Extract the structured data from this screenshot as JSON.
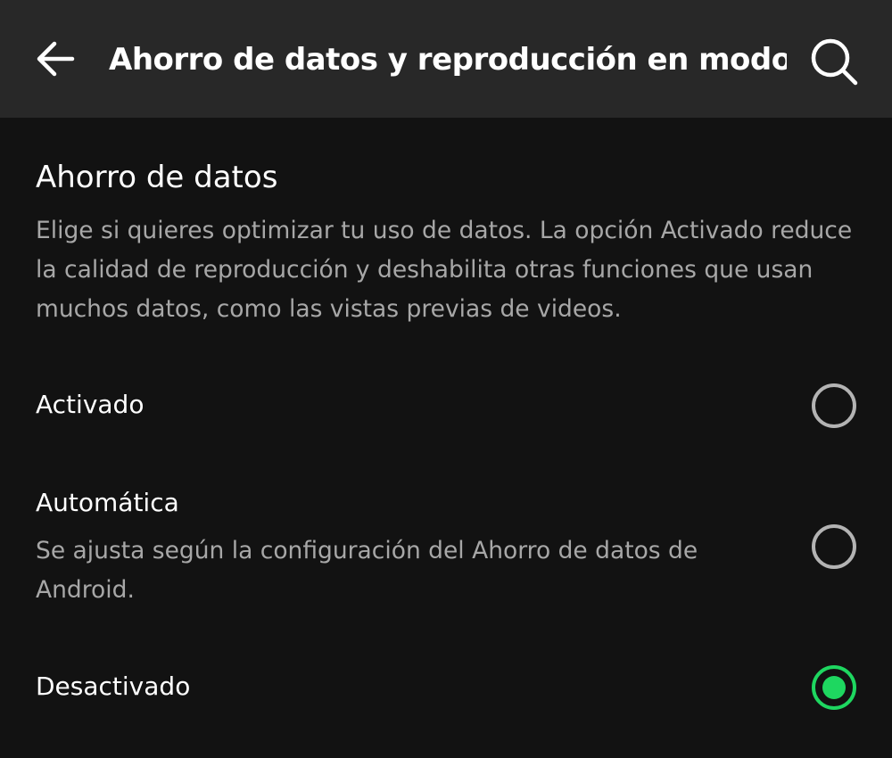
{
  "header": {
    "back_icon": "arrow-left-icon",
    "title": "Ahorro de datos y reproducción en modo...",
    "search_icon": "search-icon"
  },
  "section": {
    "title": "Ahorro de datos",
    "description": "Elige si quieres optimizar tu uso de datos. La opción Activado reduce la calidad de reproducción y deshabilita otras funciones que usan muchos datos, como las vistas previas de videos."
  },
  "options": [
    {
      "label": "Activado",
      "selected": false
    },
    {
      "label": "Automática",
      "description": "Se ajusta según la configuración del Ahorro de datos de Android.",
      "selected": false
    },
    {
      "label": "Desactivado",
      "selected": true
    }
  ],
  "colors": {
    "background": "#121212",
    "header_background": "#282828",
    "primary_text": "#ffffff",
    "secondary_text": "#a7a7a7",
    "radio_off": "#b3b3b3",
    "accent": "#1ed760"
  }
}
